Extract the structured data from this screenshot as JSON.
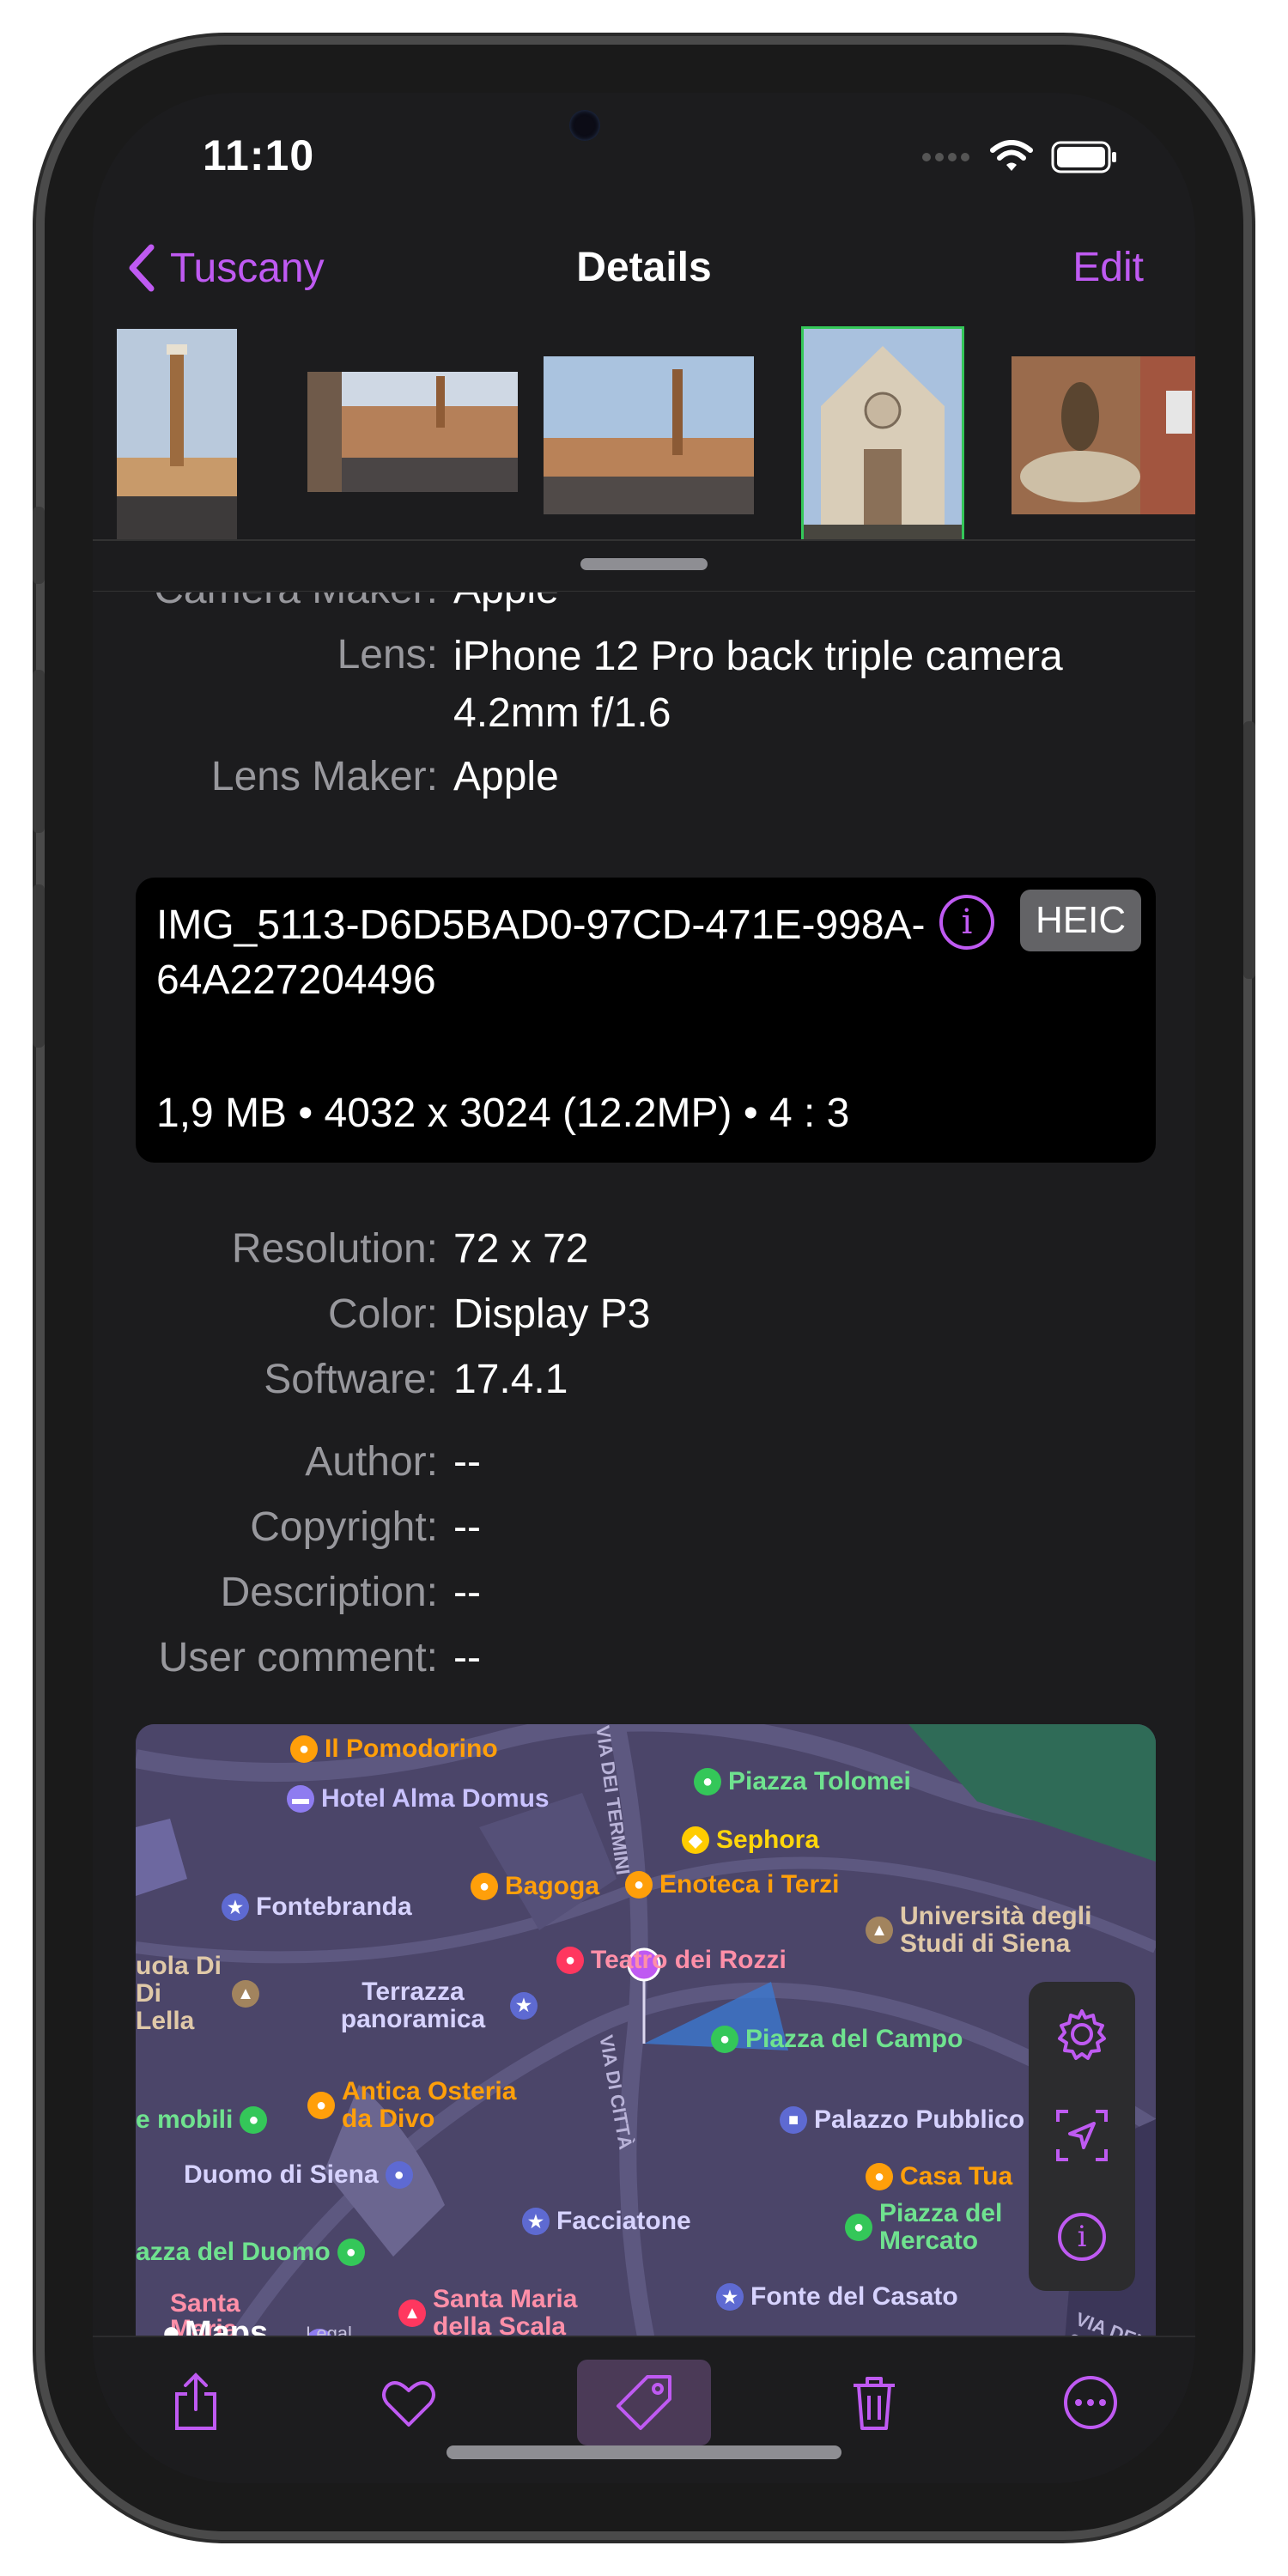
{
  "status": {
    "time": "11:10"
  },
  "nav": {
    "back_label": "Tuscany",
    "title": "Details",
    "edit_label": "Edit"
  },
  "metadata_top": [
    {
      "label": "Camera Maker:",
      "value": "Apple"
    },
    {
      "label": "Lens:",
      "value": "iPhone 12 Pro back triple camera 4.2mm f/1.6"
    },
    {
      "label": "Lens Maker:",
      "value": "Apple"
    }
  ],
  "file": {
    "name": "IMG_5113-D6D5BAD0-97CD-471E-998A-64A227204496",
    "meta": "1,9 MB • 4032 x 3024 (12.2MP) • 4 : 3",
    "format": "HEIC"
  },
  "metadata_bottom": [
    {
      "label": "Resolution:",
      "value": "72 x 72"
    },
    {
      "label": "Color:",
      "value": "Display P3"
    },
    {
      "label": "Software:",
      "value": "17.4.1"
    },
    {
      "label": "Author:",
      "value": "--"
    },
    {
      "label": "Copyright:",
      "value": "--"
    },
    {
      "label": "Description:",
      "value": "--"
    },
    {
      "label": "User comment:",
      "value": "--"
    }
  ],
  "map": {
    "attribution": "Maps",
    "legal": "Legal",
    "street_labels": [
      "VIA DEI TERMINI",
      "VIA DI CITTÀ",
      "VIA DEL SALIC"
    ],
    "pois": [
      {
        "name": "Il Pomodorino",
        "color": "#ff9f0a"
      },
      {
        "name": "Hotel Alma Domus",
        "color": "#8e7cf0"
      },
      {
        "name": "Piazza Tolomei",
        "color": "#34c759"
      },
      {
        "name": "Sephora",
        "color": "#ffcc00"
      },
      {
        "name": "Fontebranda",
        "color": "#5e6ad2"
      },
      {
        "name": "Bagoga",
        "color": "#ff9f0a"
      },
      {
        "name": "Enoteca i Terzi",
        "color": "#ff9f0a"
      },
      {
        "name": "Università degli Studi di Siena",
        "color": "#a2845e"
      },
      {
        "name": "uola Di Di Lella",
        "color": "#a2845e"
      },
      {
        "name": "Terrazza panoramica",
        "color": "#5e6ad2"
      },
      {
        "name": "Teatro dei Rozzi",
        "color": "#ff375f"
      },
      {
        "name": "Piazza del Campo",
        "color": "#34c759"
      },
      {
        "name": "Antica Osteria da Divo",
        "color": "#ff9f0a"
      },
      {
        "name": "e mobili",
        "color": "#34c759"
      },
      {
        "name": "Palazzo Pubblico",
        "color": "#5e6ad2"
      },
      {
        "name": "Duomo di Siena",
        "color": "#5e6ad2"
      },
      {
        "name": "Casa Tua",
        "color": "#ff9f0a"
      },
      {
        "name": "Facciatone",
        "color": "#5e6ad2"
      },
      {
        "name": "Piazza del Mercato",
        "color": "#34c759"
      },
      {
        "name": "azza del Duomo",
        "color": "#34c759"
      },
      {
        "name": "Santa Maria della Scala",
        "color": "#ff375f"
      },
      {
        "name": "Santa Maria della Scala",
        "color": "#ff375f"
      },
      {
        "name": "Fonte del Casato",
        "color": "#5e6ad2"
      }
    ]
  },
  "toolbar": [
    "share-icon",
    "heart-icon",
    "tag-icon",
    "trash-icon",
    "more-icon"
  ],
  "colors": {
    "accent": "#bf5af2",
    "background": "#1c1c1e",
    "card": "#000000"
  }
}
